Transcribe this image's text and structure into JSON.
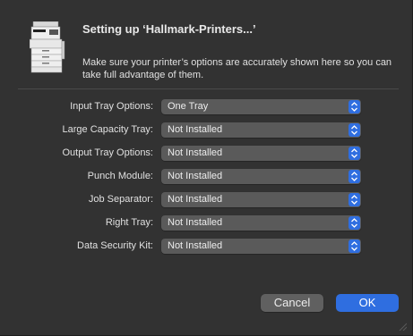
{
  "dialog": {
    "title": "Setting up ‘Hallmark-Printers...’",
    "description": "Make sure your printer’s options are accurately shown here so you can take full advantage of them.",
    "icon": "printer-icon"
  },
  "options": [
    {
      "label": "Input Tray Options:",
      "value": "One Tray"
    },
    {
      "label": "Large Capacity Tray:",
      "value": "Not Installed"
    },
    {
      "label": "Output Tray Options:",
      "value": "Not Installed"
    },
    {
      "label": "Punch Module:",
      "value": "Not Installed"
    },
    {
      "label": "Job Separator:",
      "value": "Not Installed"
    },
    {
      "label": "Right Tray:",
      "value": "Not Installed"
    },
    {
      "label": "Data Security Kit:",
      "value": "Not Installed"
    }
  ],
  "buttons": {
    "cancel": "Cancel",
    "ok": "OK"
  },
  "colors": {
    "accent": "#2f6ee0",
    "background": "#323232",
    "popup": "#5a5a5a"
  }
}
